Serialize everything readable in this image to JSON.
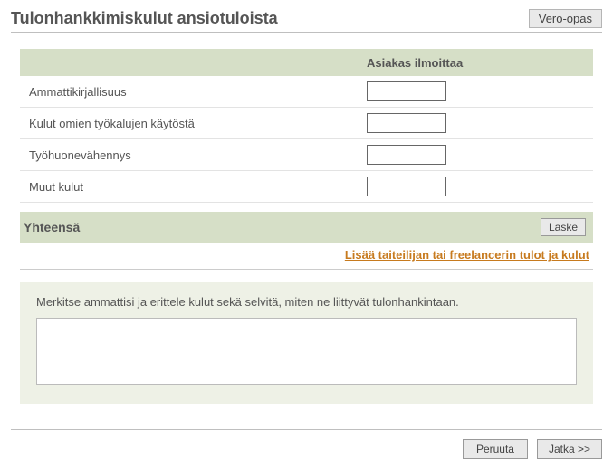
{
  "header": {
    "title": "Tulonhankkimiskulut ansiotuloista",
    "guide_button": "Vero-opas"
  },
  "columns": {
    "input_header": "Asiakas ilmoittaa"
  },
  "fields": [
    {
      "label": "Ammattikirjallisuus",
      "value": ""
    },
    {
      "label": "Kulut omien työkalujen käytöstä",
      "value": ""
    },
    {
      "label": "Työhuonevähennys",
      "value": ""
    },
    {
      "label": "Muut kulut",
      "value": ""
    }
  ],
  "total": {
    "label": "Yhteensä",
    "calc_button": "Laske"
  },
  "add_link": "Lisää taiteilijan tai freelancerin tulot ja kulut",
  "notes": {
    "label": "Merkitse ammattisi ja erittele kulut sekä selvitä, miten ne liittyvät tulonhankintaan.",
    "value": ""
  },
  "footer": {
    "cancel": "Peruuta",
    "continue": "Jatka  >>"
  }
}
